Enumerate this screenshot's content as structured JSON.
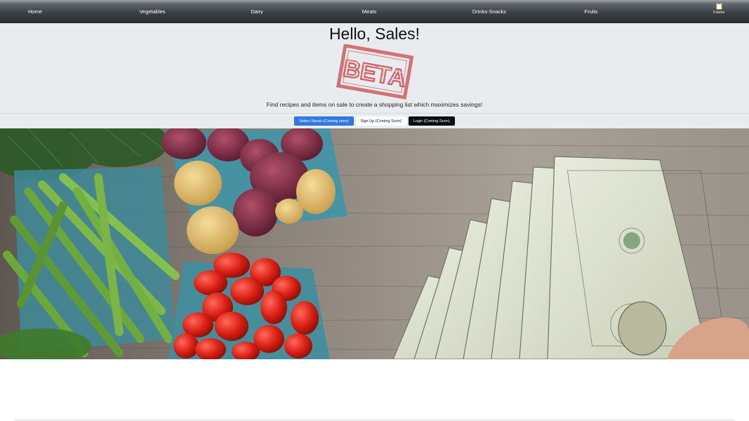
{
  "nav": {
    "items": [
      "Home",
      "Vegetables",
      "Dairy",
      "Meats",
      "Drinks-Snacks",
      "Fruits"
    ],
    "cart_count": "0 items",
    "cart_icon": "clipboard-icon"
  },
  "header": {
    "greeting": "Hello, Sales!",
    "stamp_text": "BETA",
    "tagline": "Find recipes and items on sale to create a shopping list which maximizes savings!"
  },
  "buttons": {
    "select_stores": "Select Stores (Coming soon)",
    "sign_up": "Sign Up (Coming Soon)",
    "login": "Login (Coming Soon)"
  },
  "hero": {
    "description_icon": "groceries-and-cash-photo"
  },
  "colors": {
    "primary": "#2f7ae5",
    "dark": "#0d0d0d",
    "header_bg": "#e9ecef",
    "stamp": "#c9484e"
  }
}
